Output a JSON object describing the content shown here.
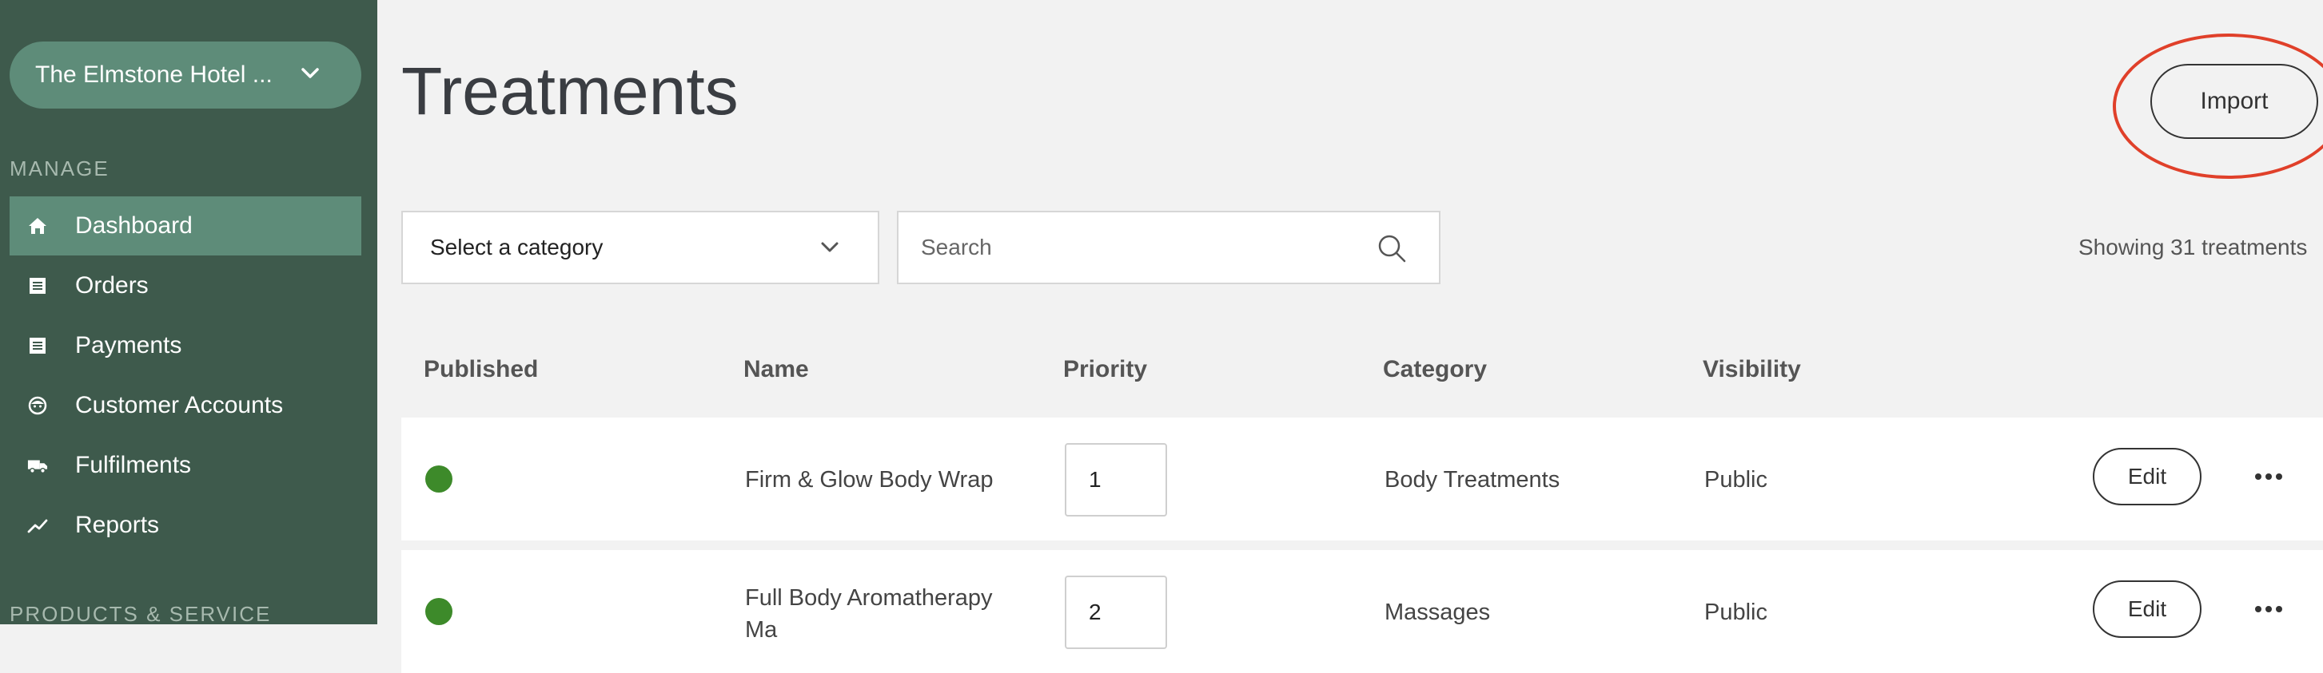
{
  "sidebar": {
    "venue": "The Elmstone Hotel ...",
    "manage_label": "MANAGE",
    "items": [
      {
        "label": "Dashboard",
        "icon": "home-icon"
      },
      {
        "label": "Orders",
        "icon": "list-icon"
      },
      {
        "label": "Payments",
        "icon": "list-icon"
      },
      {
        "label": "Customer Accounts",
        "icon": "face-icon"
      },
      {
        "label": "Fulfilments",
        "icon": "truck-icon"
      },
      {
        "label": "Reports",
        "icon": "trend-icon"
      }
    ],
    "products_label": "PRODUCTS & SERVICE"
  },
  "page": {
    "title": "Treatments",
    "import_label": "Import",
    "highlight_color": "#e0402a"
  },
  "filters": {
    "category_placeholder": "Select a category",
    "search_placeholder": "Search",
    "count_text": "Showing 31 treatments"
  },
  "table": {
    "headers": [
      "Published",
      "Name",
      "Priority",
      "Category",
      "Visibility"
    ],
    "rows": [
      {
        "published": true,
        "name": "Firm & Glow Body Wrap",
        "priority": "1",
        "category": "Body Treatments",
        "visibility": "Public",
        "edit_label": "Edit"
      },
      {
        "published": true,
        "name": "Full Body Aromatherapy Ma",
        "priority": "2",
        "category": "Massages",
        "visibility": "Public",
        "edit_label": "Edit"
      }
    ]
  },
  "colors": {
    "sidebar_bg": "#3e5a4c",
    "accent": "#5e8c79",
    "published_dot": "#3d8a2a"
  }
}
